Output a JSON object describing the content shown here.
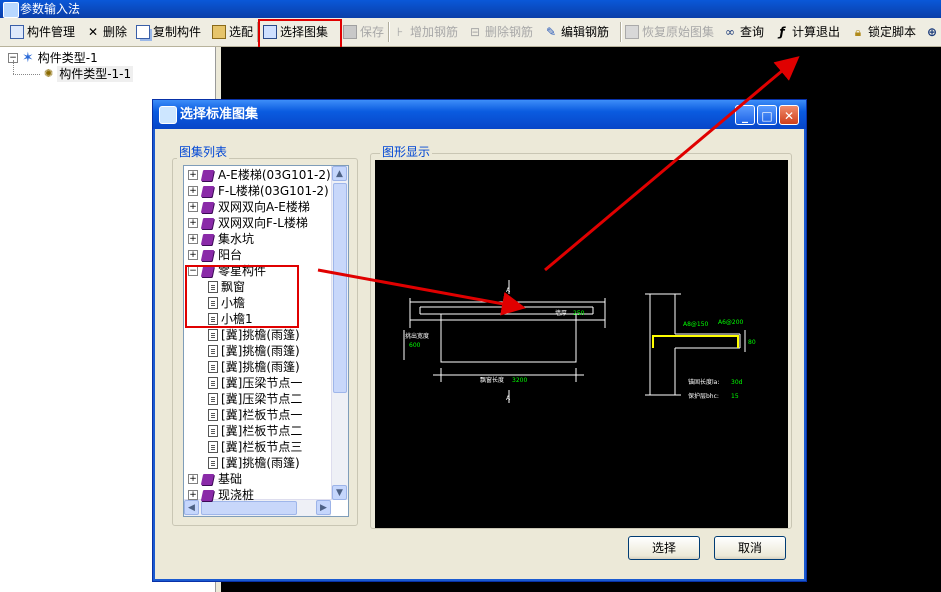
{
  "app": {
    "title": "参数输入法"
  },
  "toolbar": {
    "items": [
      {
        "label": "构件管理",
        "icon": "component-manage-icon",
        "disabled": false
      },
      {
        "label": "删除",
        "icon": "delete-icon",
        "disabled": false
      },
      {
        "label": "复制构件",
        "icon": "copy-component-icon",
        "disabled": false
      },
      {
        "label": "选配",
        "icon": "select-config-icon",
        "disabled": false
      },
      {
        "label": "选择图集",
        "icon": "select-atlas-icon",
        "disabled": false
      },
      {
        "label": "保存",
        "icon": "save-icon",
        "disabled": true
      },
      {
        "label": "增加钢筋",
        "icon": "add-rebar-icon",
        "disabled": true
      },
      {
        "label": "删除钢筋",
        "icon": "delete-rebar-icon",
        "disabled": true
      },
      {
        "label": "编辑钢筋",
        "icon": "edit-rebar-icon",
        "disabled": false
      },
      {
        "label": "恢复原始图集",
        "icon": "restore-atlas-icon",
        "disabled": true
      },
      {
        "label": "查询",
        "icon": "binoculars-icon",
        "disabled": false
      },
      {
        "label": "计算退出",
        "icon": "fx-icon",
        "disabled": false
      },
      {
        "label": "锁定脚本",
        "icon": "lock-icon",
        "disabled": false
      }
    ]
  },
  "left_tree": {
    "root": "构件类型-1",
    "child": "构件类型-1-1"
  },
  "dialog": {
    "title": "选择标准图集",
    "list_group_label": "图集列表",
    "graphic_group_label": "图形显示",
    "select_button": "选择",
    "cancel_button": "取消",
    "tree": [
      {
        "label": "A-E楼梯(03G101-2)",
        "kind": "book",
        "expander": "+",
        "level": 0
      },
      {
        "label": "F-L楼梯(03G101-2)",
        "kind": "book",
        "expander": "+",
        "level": 0
      },
      {
        "label": "双网双向A-E楼梯",
        "kind": "book",
        "expander": "+",
        "level": 0
      },
      {
        "label": "双网双向F-L楼梯",
        "kind": "book",
        "expander": "+",
        "level": 0
      },
      {
        "label": "集水坑",
        "kind": "book",
        "expander": "+",
        "level": 0
      },
      {
        "label": "阳台",
        "kind": "book",
        "expander": "+",
        "level": 0
      },
      {
        "label": "零星构件",
        "kind": "book-open",
        "expander": "-",
        "level": 0
      },
      {
        "label": "飘窗",
        "kind": "doc",
        "expander": "",
        "level": 1
      },
      {
        "label": "小檐",
        "kind": "doc",
        "expander": "",
        "level": 1
      },
      {
        "label": "小檐1",
        "kind": "doc",
        "expander": "",
        "level": 1
      },
      {
        "label": "[冀]挑檐(雨篷)",
        "kind": "doc",
        "expander": "",
        "level": 1
      },
      {
        "label": "[冀]挑檐(雨篷)",
        "kind": "doc",
        "expander": "",
        "level": 1
      },
      {
        "label": "[冀]挑檐(雨篷)",
        "kind": "doc",
        "expander": "",
        "level": 1
      },
      {
        "label": "[冀]压梁节点一",
        "kind": "doc",
        "expander": "",
        "level": 1
      },
      {
        "label": "[冀]压梁节点二",
        "kind": "doc",
        "expander": "",
        "level": 1
      },
      {
        "label": "[冀]栏板节点一",
        "kind": "doc",
        "expander": "",
        "level": 1
      },
      {
        "label": "[冀]栏板节点二",
        "kind": "doc",
        "expander": "",
        "level": 1
      },
      {
        "label": "[冀]栏板节点三",
        "kind": "doc",
        "expander": "",
        "level": 1
      },
      {
        "label": "[冀]挑檐(雨篷)",
        "kind": "doc",
        "expander": "",
        "level": 1
      },
      {
        "label": "基础",
        "kind": "book",
        "expander": "+",
        "level": 0
      },
      {
        "label": "现浇桩",
        "kind": "book",
        "expander": "+",
        "level": 0
      }
    ],
    "drawing": {
      "label_wall_thickness": "墙厚",
      "value_wall_thickness": "250",
      "label_overhang_height": "挑出宽度",
      "value_overhang_height": "600",
      "label_window_length": "飘窗长度",
      "value_window_length": "3200",
      "label_a1": "A8@150",
      "label_a2": "A6@200",
      "value_side": "80",
      "label_anchor": "锚固长度la:",
      "value_anchor": "30d",
      "label_cover": "保护层bhc:",
      "value_cover": "15",
      "section_mark": "A"
    }
  },
  "colors": {
    "highlight": "#e00000",
    "drawing_value": "#00ff00",
    "rebar": "#ffff00"
  }
}
